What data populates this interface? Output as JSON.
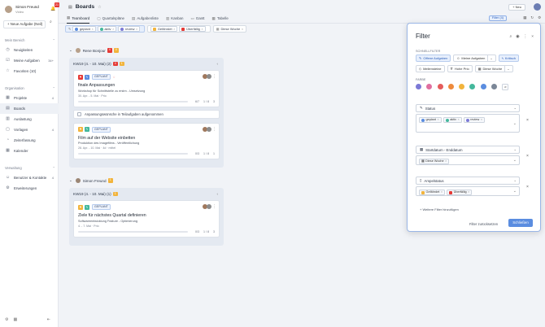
{
  "sidebar": {
    "user_name": "Simon Freund",
    "user_sub": "Video",
    "notif_count": "21",
    "new_task": "+ Neue Aufgabe (Neil)",
    "sections": {
      "mein_bereich": "Mein Bereich",
      "organisation": "Organisation",
      "verwaltung": "Verwaltung"
    },
    "items": [
      {
        "label": "Neuigkeiten",
        "icon": "◷"
      },
      {
        "label": "Meine Aufgaben",
        "icon": "☑",
        "count": "34+"
      },
      {
        "label": "Favoriten (10)",
        "icon": "☆"
      },
      {
        "label": "Projekte",
        "icon": "▦",
        "count": "4"
      },
      {
        "label": "Boards",
        "icon": "▤"
      },
      {
        "label": "Auslastung",
        "icon": "▥"
      },
      {
        "label": "Vorlagen",
        "icon": "▢",
        "count": "4"
      },
      {
        "label": "Zeiterfassung",
        "icon": "◔"
      },
      {
        "label": "Kalender",
        "icon": "▦"
      },
      {
        "label": "Benutzer & Kontakte",
        "icon": "☺",
        "count": "4"
      },
      {
        "label": "Erweiterungen",
        "icon": "⚙"
      }
    ]
  },
  "topbar": {
    "title": "Boards",
    "new_btn": "+ Neu"
  },
  "tabs": [
    {
      "label": "Teamboard",
      "icon": "▦"
    },
    {
      "label": "Quartalspläne",
      "icon": "▢"
    },
    {
      "label": "Aufgabenliste",
      "icon": "▤"
    },
    {
      "label": "Kanban",
      "icon": "▥"
    },
    {
      "label": "Gantt",
      "icon": "▭"
    },
    {
      "label": "Tabelle",
      "icon": "▦"
    }
  ],
  "filter_btn": "Filter (4)",
  "chips": {
    "status": [
      "geplant",
      "aktiv",
      "review"
    ],
    "ampel": [
      "Gefährdet",
      "Überfällig"
    ],
    "zeit": "Diese Woche"
  },
  "groups": [
    {
      "user": "Rene Bonjour",
      "badges": [
        "4",
        "4"
      ],
      "lane_title": "KW19 (4. - 10. Mai) (2)",
      "lane_badges": [
        "4",
        "1"
      ],
      "cards": [
        {
          "status": "GEPLANT",
          "title": "finale Anpassungen",
          "desc": "Workshop für Schnittstelle zu erstm - Umsetzung",
          "meta": "30. Apr. - 5. Mai · Prio",
          "stats": [
            "6/7",
            "1 / 8",
            "3"
          ],
          "subtask": "Anpassungswünsche in Teilaufgaben aufgenommen"
        },
        {
          "status": "GEPLANT",
          "title": "Film auf der Website einbetten",
          "desc": "Produktion des Imagefilms - Veröffentlichung",
          "meta": "28. Apr. - 10. Mai · 4d · mittel",
          "stats": [
            "0/3",
            "1 / 8",
            "1"
          ]
        }
      ]
    },
    {
      "user": "Simon Freund",
      "badges": [
        "1"
      ],
      "lane_title": "KW19 (4. - 10. Mai) (1)",
      "lane_badges": [
        "1"
      ],
      "cards": [
        {
          "status": "GEPLANT",
          "title": "Ziele für nächstes Quartal definieren",
          "desc": "Softwareentwicklung Feature - Optimierung",
          "meta": "4. - 7. Mai · Prio",
          "stats": [
            "0/3",
            "1 / 8",
            "3"
          ]
        }
      ]
    }
  ],
  "filter_panel": {
    "title": "Filter",
    "quick_label": "SCHNELLFILTER",
    "quick": [
      "Offene Aufgaben",
      "Meine Aufgaben",
      "Kritisch",
      "Meilensteine",
      "Hohe Prio",
      "Diese Woche"
    ],
    "colors_label": "FARBE",
    "colors": [
      "#7b79d6",
      "#e06fa0",
      "#e55c5c",
      "#ee8a3c",
      "#f2b43c",
      "#44b89c",
      "#5b8de0",
      "#7b8797"
    ],
    "status_label": "Status",
    "status_values": [
      "geplant",
      "aktiv",
      "review"
    ],
    "date_label": "Startdatum - Enddatum",
    "date_value": "Diese Woche",
    "ampel_label": "Ampelstatus",
    "ampel_values": [
      "Gefährdet",
      "Überfällig"
    ],
    "add_filter": "+ Weitere Filter hinzufügen",
    "reset": "Filter zurücksetzen",
    "close": "Schließen"
  },
  "colors": {
    "accent": "#5b8de0",
    "danger": "#e53935",
    "warning": "#f2b43c",
    "success": "#44b89c"
  }
}
